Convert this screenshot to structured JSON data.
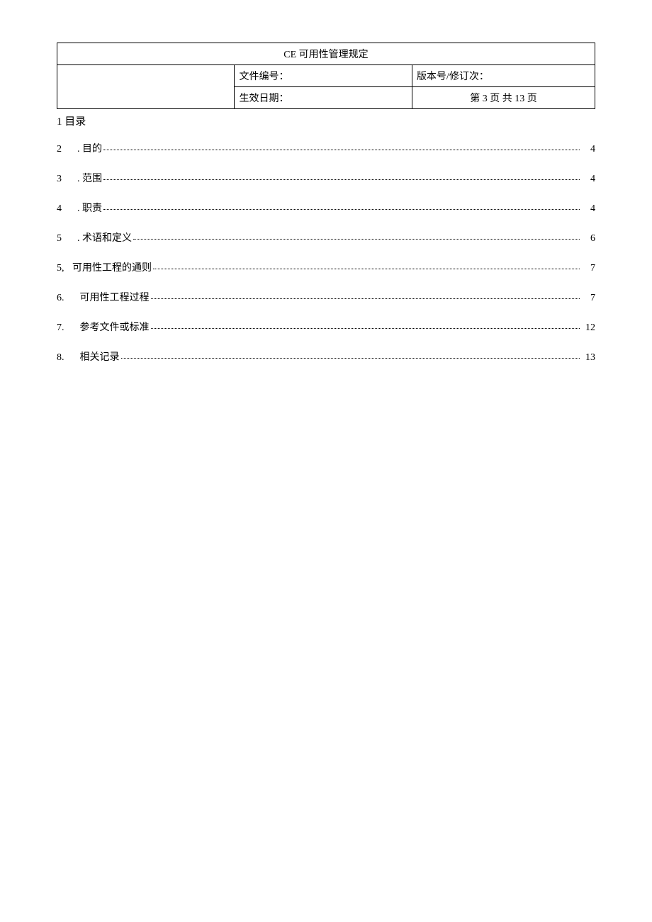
{
  "header": {
    "title": "CE 可用性管理规定",
    "doc_no_label": "文件编号：",
    "version_label": "版本号/修订次：",
    "effective_label": "生效日期：",
    "page_text": "第 3 页 共 13 页"
  },
  "toc_heading": "1  目录",
  "toc": [
    {
      "num": "2",
      "sep": "  . ",
      "label": "目的",
      "page": "4"
    },
    {
      "num": "3",
      "sep": "  . ",
      "label": "范围",
      "page": "4"
    },
    {
      "num": "4",
      "sep": "  . ",
      "label": "职责",
      "page": "4"
    },
    {
      "num": "5",
      "sep": "  . ",
      "label": "术语和定义",
      "page": "6"
    },
    {
      "num": "5,",
      "sep": "",
      "label": "可用性工程的通则",
      "page": "7"
    },
    {
      "num": "6.",
      "sep": "   ",
      "label": "可用性工程过程",
      "page": "7"
    },
    {
      "num": "7.",
      "sep": "   ",
      "label": "参考文件或标准",
      "page": "12"
    },
    {
      "num": "8.",
      "sep": "   ",
      "label": "相关记录",
      "page": "13"
    }
  ]
}
